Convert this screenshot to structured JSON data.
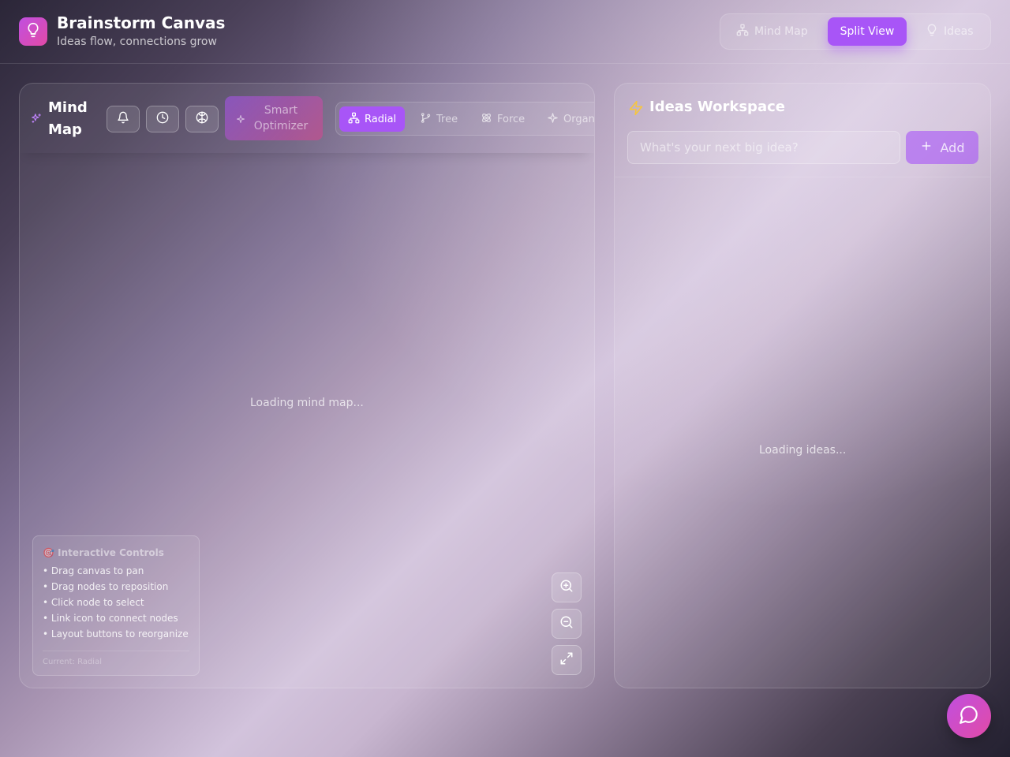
{
  "header": {
    "title": "Brainstorm Canvas",
    "subtitle": "Ideas flow, connections grow",
    "logo_icon": "lightbulb-icon",
    "view_tabs": [
      {
        "label": "Mind Map",
        "icon": "network-icon",
        "active": false
      },
      {
        "label": "Split View",
        "active": true
      },
      {
        "label": "Ideas",
        "icon": "lightbulb-icon",
        "active": false
      }
    ]
  },
  "mindmap": {
    "title": "Mind Map",
    "title_icon": "sparkles-icon",
    "toolbar_icons": [
      "bell-icon",
      "clock-icon",
      "brain-icon"
    ],
    "optimizer_label": "Smart Optimizer",
    "layouts": [
      {
        "label": "Radial",
        "icon": "network-icon",
        "active": true
      },
      {
        "label": "Tree",
        "icon": "git-branch-icon",
        "active": false
      },
      {
        "label": "Force",
        "icon": "atom-icon",
        "active": false
      },
      {
        "label": "Organ",
        "icon": "sparkle-icon",
        "active": false
      }
    ],
    "loading": "Loading mind map...",
    "controls": {
      "title": "🎯 Interactive Controls",
      "items": [
        "• Drag canvas to pan",
        "• Drag nodes to reposition",
        "• Click node to select",
        "• Link icon to connect nodes",
        "• Layout buttons to reorganize"
      ],
      "status": "Current: Radial"
    },
    "zoom_controls": [
      "zoom-in-icon",
      "zoom-out-icon",
      "fullscreen-icon"
    ]
  },
  "ideas": {
    "title": "Ideas Workspace",
    "title_icon": "zap-icon",
    "input_placeholder": "What's your next big idea?",
    "add_label": "Add",
    "loading": "Loading ideas..."
  },
  "chat": {
    "icon": "chat-bubble-icon"
  },
  "colors": {
    "accent": "#a855f7",
    "accent_pink": "#e24aa6",
    "highlight_yellow": "#f5c543"
  }
}
